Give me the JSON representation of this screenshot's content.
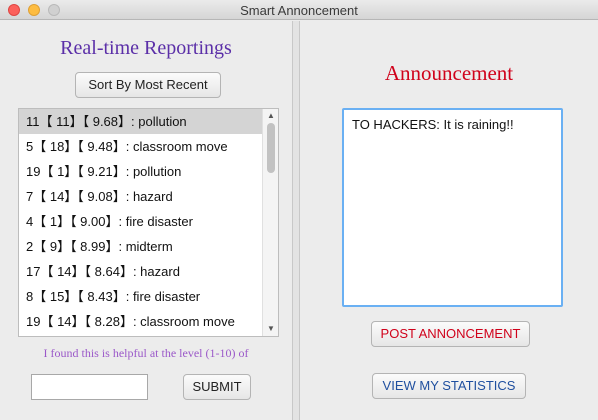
{
  "window": {
    "title": "Smart Annoncement"
  },
  "left": {
    "title": "Real-time Reportings",
    "sort_button": "Sort By Most Recent",
    "reports": [
      {
        "text": "11【 11】【 9.68】: pollution",
        "selected": true
      },
      {
        "text": "5【 18】【 9.48】: classroom move",
        "selected": false
      },
      {
        "text": "19【 1】【 9.21】: pollution",
        "selected": false
      },
      {
        "text": "7【 14】【 9.08】: hazard",
        "selected": false
      },
      {
        "text": "4【 1】【 9.00】: fire disaster",
        "selected": false
      },
      {
        "text": "2【 9】【 8.99】: midterm",
        "selected": false
      },
      {
        "text": "17【 14】【 8.64】: hazard",
        "selected": false
      },
      {
        "text": "8【 15】【 8.43】: fire disaster",
        "selected": false
      },
      {
        "text": "19【 14】【 8.28】: classroom move",
        "selected": false
      }
    ],
    "helpful_text": "I found this is helpful at the level (1-10) of",
    "rating_value": "",
    "submit_button": "SUBMIT"
  },
  "right": {
    "title": "Announcement",
    "announcement_text": "TO HACKERS: It is raining!!",
    "post_button": "POST ANNONCEMENT",
    "stats_button": "VIEW MY STATISTICS"
  },
  "colors": {
    "left_title": "#5b2fa8",
    "right_title": "#d0021b",
    "post_button_text": "#d0021b",
    "stats_button_text": "#1f4f9f",
    "helpful_text": "#9b59c9",
    "focus_border": "#6ab0f3"
  }
}
